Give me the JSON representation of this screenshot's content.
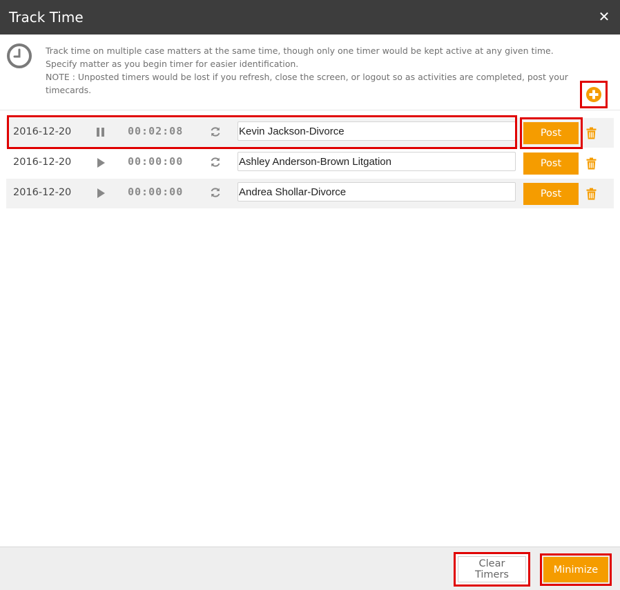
{
  "dialog": {
    "title": "Track Time",
    "close_icon": "close-icon",
    "close_glyph": "✕"
  },
  "info": {
    "icon": "clock-icon",
    "line1": "Track time on multiple case matters at the same time, though only one timer would be kept active at any given time. Specify matter as you begin timer for easier identification.",
    "line2": "NOTE : Unposted timers would be lost if you refresh, close the screen, or logout so as activities are completed, post your timecards.",
    "add_icon": "plus-circle-icon"
  },
  "timers": [
    {
      "date": "2016-12-20",
      "state": "running",
      "state_icon": "pause-icon",
      "elapsed": "00:02:08",
      "matter": "Kevin Jackson-Divorce",
      "post_label": "Post"
    },
    {
      "date": "2016-12-20",
      "state": "stopped",
      "state_icon": "play-icon",
      "elapsed": "00:00:00",
      "matter": "Ashley Anderson-Brown Litgation",
      "post_label": "Post"
    },
    {
      "date": "2016-12-20",
      "state": "stopped",
      "state_icon": "play-icon",
      "elapsed": "00:00:00",
      "matter": "Andrea Shollar-Divorce",
      "post_label": "Post"
    }
  ],
  "footer": {
    "clear_label": "Clear Timers",
    "minimize_label": "Minimize"
  },
  "colors": {
    "accent": "#f59c00",
    "titlebar": "#3d3d3d",
    "highlight": "#e00000"
  }
}
